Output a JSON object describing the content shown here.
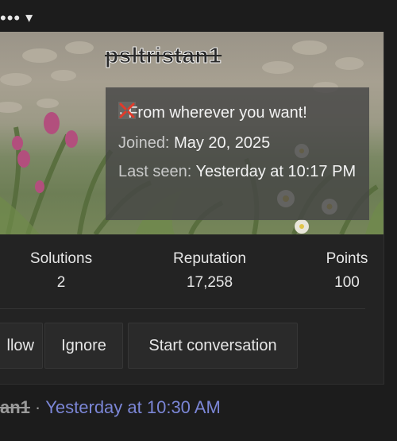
{
  "top_menu": {
    "dots": "•••",
    "caret": "▾"
  },
  "profile": {
    "username": "psltristan1",
    "location_prefix": "· From wherever you want!",
    "joined_label": "Joined:",
    "joined_value": "May 20, 2025",
    "last_seen_label": "Last seen:",
    "last_seen_value": "Yesterday at 10:17 PM"
  },
  "stats": [
    {
      "label": "Solutions",
      "value": "2"
    },
    {
      "label": "Reputation",
      "value": "17,258"
    },
    {
      "label": "Points",
      "value": "100"
    }
  ],
  "buttons": {
    "follow": "llow",
    "ignore": "Ignore",
    "start_conversation": "Start conversation"
  },
  "footer": {
    "user": "an1",
    "separator": "·",
    "time": "Yesterday at 10:30 AM"
  },
  "colors": {
    "link": "#7b86d6",
    "background": "#1c1c1c",
    "card": "#232323"
  }
}
